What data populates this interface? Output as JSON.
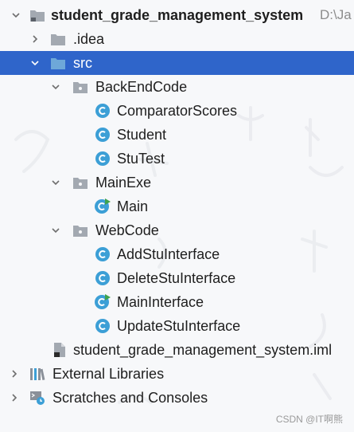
{
  "tree": {
    "root": {
      "label": "student_grade_management_system",
      "path": "D:\\Ja"
    },
    "idea": {
      "label": ".idea"
    },
    "src": {
      "label": "src"
    },
    "backend": {
      "label": "BackEndCode"
    },
    "comparator": {
      "label": "ComparatorScores"
    },
    "student": {
      "label": "Student"
    },
    "stutest": {
      "label": "StuTest"
    },
    "mainexe": {
      "label": "MainExe"
    },
    "main": {
      "label": "Main"
    },
    "webcode": {
      "label": "WebCode"
    },
    "addstu": {
      "label": "AddStuInterface"
    },
    "deletestu": {
      "label": "DeleteStuInterface"
    },
    "maininterface": {
      "label": "MainInterface"
    },
    "updatestu": {
      "label": "UpdateStuInterface"
    },
    "iml": {
      "label": "student_grade_management_system.iml"
    },
    "extlibs": {
      "label": "External Libraries"
    },
    "scratches": {
      "label": "Scratches and Consoles"
    }
  },
  "watermark": "CSDN @IT啊熊",
  "colors": {
    "selection": "#2f65ca",
    "class_icon": "#3c9fd6",
    "folder": "#a3a9b1",
    "src_folder": "#6ea8d9",
    "run_badge": "#3fa34d"
  }
}
